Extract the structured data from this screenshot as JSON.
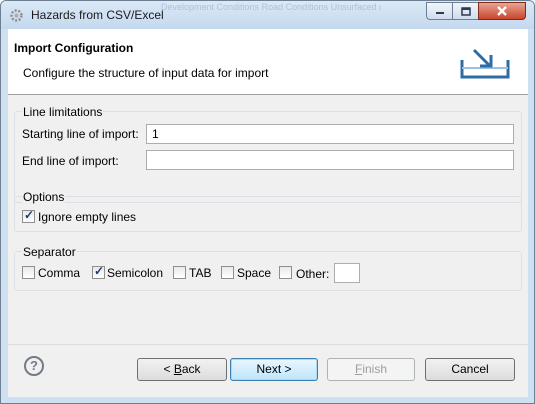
{
  "window": {
    "title": "Hazards from CSV/Excel",
    "background_ghost_text": [
      "Development Conditions",
      "Road Conditions",
      "Unsurfaced conditions"
    ]
  },
  "header": {
    "title": "Import Configuration",
    "description": "Configure the structure of input data for import",
    "icon": "import-tray-icon"
  },
  "line_limitations": {
    "title": "Line limitations",
    "starting_line_label": "Starting line of import:",
    "starting_line_value": "1",
    "end_line_label": "End line of import:",
    "end_line_value": ""
  },
  "options": {
    "title": "Options",
    "ignore_empty_label": "Ignore empty lines",
    "ignore_empty_checked": true
  },
  "separator": {
    "title": "Separator",
    "items": [
      {
        "label": "Comma",
        "checked": false
      },
      {
        "label": "Semicolon",
        "checked": true
      },
      {
        "label": "TAB",
        "checked": false
      },
      {
        "label": "Space",
        "checked": false
      },
      {
        "label": "Other:",
        "checked": false
      }
    ],
    "other_value": ""
  },
  "footer": {
    "help": "?",
    "back_mnemonic": "< ",
    "back_u": "B",
    "back_rest": "ack",
    "next_label": "Next >",
    "finish_u": "F",
    "finish_rest": "inish",
    "cancel_label": "Cancel"
  },
  "colors": {
    "titlebar": "#c4d8ee",
    "dialog_bg": "#f0f0f0",
    "default_button": "#bee6fd",
    "disabled_text": "#9d9d9d"
  }
}
